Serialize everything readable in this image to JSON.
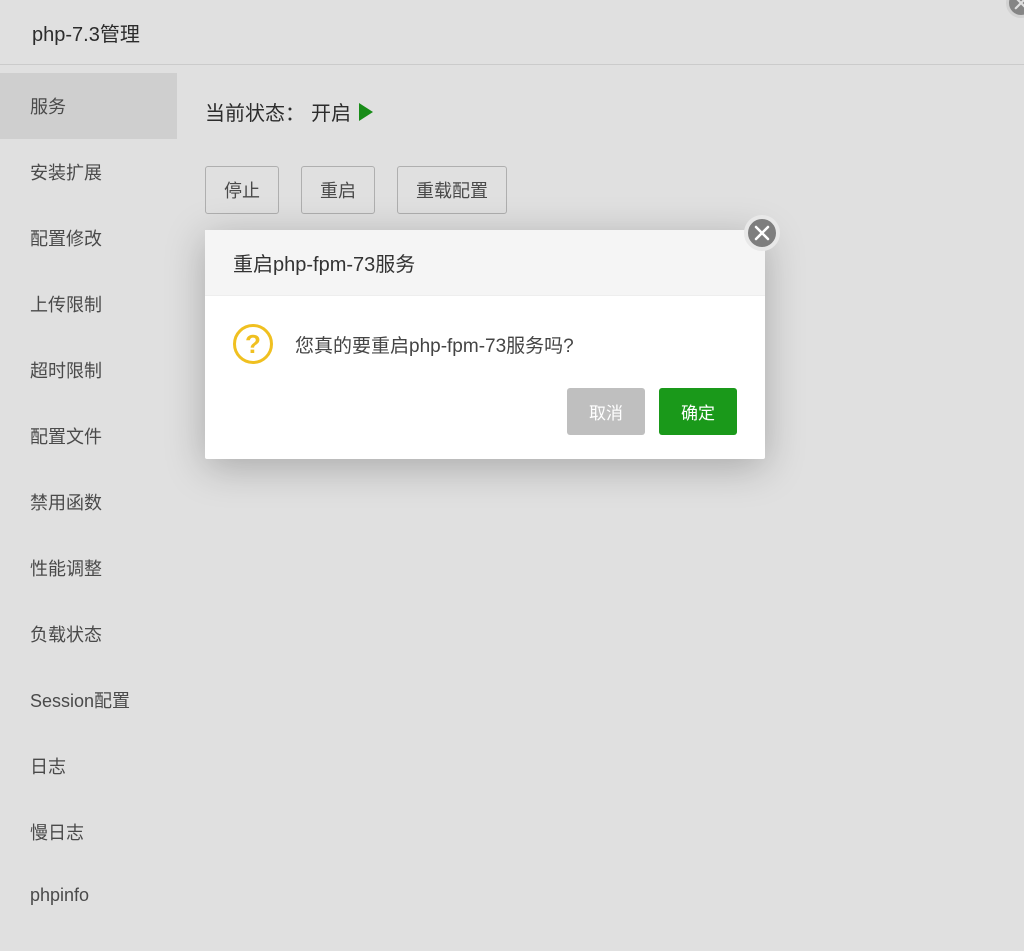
{
  "header": {
    "title": "php-7.3管理"
  },
  "sidebar": {
    "items": [
      {
        "label": "服务",
        "active": true
      },
      {
        "label": "安装扩展",
        "active": false
      },
      {
        "label": "配置修改",
        "active": false
      },
      {
        "label": "上传限制",
        "active": false
      },
      {
        "label": "超时限制",
        "active": false
      },
      {
        "label": "配置文件",
        "active": false
      },
      {
        "label": "禁用函数",
        "active": false
      },
      {
        "label": "性能调整",
        "active": false
      },
      {
        "label": "负载状态",
        "active": false
      },
      {
        "label": "Session配置",
        "active": false
      },
      {
        "label": "日志",
        "active": false
      },
      {
        "label": "慢日志",
        "active": false
      },
      {
        "label": "phpinfo",
        "active": false
      }
    ]
  },
  "main": {
    "status_label": "当前状态：",
    "status_value": "开启",
    "actions": {
      "stop": "停止",
      "restart": "重启",
      "reload": "重载配置"
    }
  },
  "dialog": {
    "title": "重启php-fpm-73服务",
    "message": "您真的要重启php-fpm-73服务吗?",
    "cancel": "取消",
    "confirm": "确定"
  }
}
